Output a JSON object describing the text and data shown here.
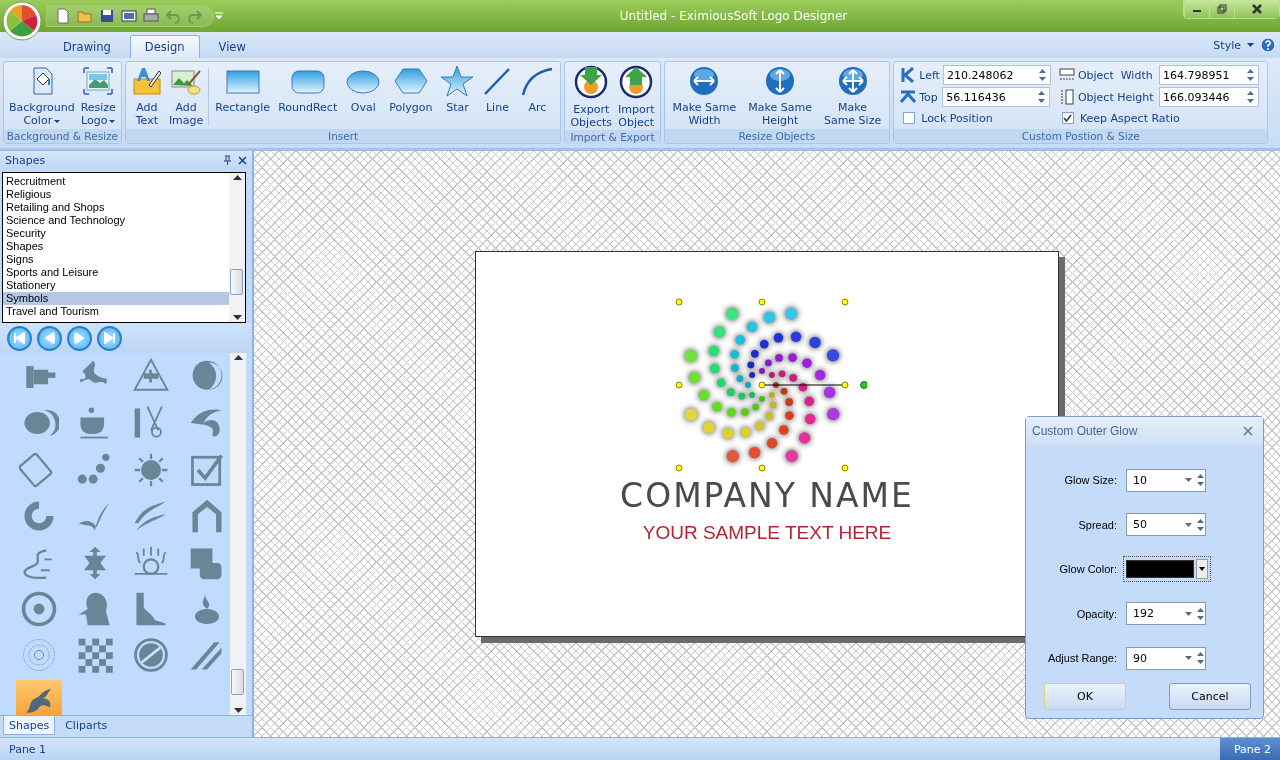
{
  "window": {
    "title": "Untitled - EximiousSoft Logo Designer"
  },
  "tabs": [
    {
      "label": "Drawing",
      "selected": false
    },
    {
      "label": "Design",
      "selected": true
    },
    {
      "label": "View",
      "selected": false
    }
  ],
  "style_menu": {
    "label": "Style"
  },
  "ribbon_groups": [
    {
      "title": "Background & Resize",
      "buttons": [
        {
          "label": "Background\nColor",
          "kind": "paint",
          "dropdown": true
        },
        {
          "label": "Resize\nLogo",
          "kind": "resize",
          "dropdown": true
        }
      ]
    },
    {
      "title": "Insert",
      "buttons": [
        {
          "label": "Add\nText",
          "kind": "text",
          "dropdown": false
        },
        {
          "label": "Add\nImage",
          "kind": "image",
          "dropdown": false
        },
        {
          "label": "Rectangle",
          "kind": "rect",
          "dropdown": false
        },
        {
          "label": "RoundRect",
          "kind": "roundrect",
          "dropdown": false
        },
        {
          "label": "Oval",
          "kind": "oval",
          "dropdown": false
        },
        {
          "label": "Polygon",
          "kind": "polygon",
          "dropdown": false
        },
        {
          "label": "Star",
          "kind": "star",
          "dropdown": false
        },
        {
          "label": "Line",
          "kind": "line",
          "dropdown": false
        },
        {
          "label": "Arc",
          "kind": "arc",
          "dropdown": false
        }
      ]
    },
    {
      "title": "Import & Export",
      "buttons": [
        {
          "label": "Export\nObjects",
          "kind": "export",
          "dropdown": false
        },
        {
          "label": "Import\nObject",
          "kind": "import",
          "dropdown": false
        }
      ]
    },
    {
      "title": "Resize Objects",
      "buttons": [
        {
          "label": "Make Same\nWidth",
          "kind": "width",
          "dropdown": false
        },
        {
          "label": "Make Same\nHeight",
          "kind": "height",
          "dropdown": false
        },
        {
          "label": "Make\nSame Size",
          "kind": "size",
          "dropdown": false
        }
      ]
    }
  ],
  "position_group": {
    "title": "Custom Postion & Size",
    "fields": [
      {
        "label": "Left",
        "value": "210.248062",
        "kind": "left"
      },
      {
        "label": "Top",
        "value": "56.116436",
        "kind": "top"
      },
      {
        "label": "Object  Width",
        "value": "164.798951",
        "kind": "width"
      },
      {
        "label": "Object Height",
        "value": "166.093446",
        "kind": "height"
      }
    ],
    "checkboxes": [
      {
        "label": "Lock Position",
        "checked": false
      },
      {
        "label": "Keep Aspect Ratio",
        "checked": true
      }
    ]
  },
  "shapes_panel": {
    "title": "Shapes",
    "categories": [
      {
        "label": "Recruitment",
        "selected": false
      },
      {
        "label": "Religious",
        "selected": false
      },
      {
        "label": "Retailing and Shops",
        "selected": false
      },
      {
        "label": "Science and Technology",
        "selected": false
      },
      {
        "label": "Security",
        "selected": false
      },
      {
        "label": "Shapes",
        "selected": false
      },
      {
        "label": "Signs",
        "selected": false
      },
      {
        "label": "Sports and Leisure",
        "selected": false
      },
      {
        "label": "Stationery",
        "selected": false
      },
      {
        "label": "Symbols",
        "selected": true
      },
      {
        "label": "Travel and Tourism",
        "selected": false
      }
    ],
    "thumbnails": [
      {
        "selected": false
      },
      {
        "selected": false
      },
      {
        "selected": false
      },
      {
        "selected": false
      },
      {
        "selected": false
      },
      {
        "selected": false
      },
      {
        "selected": false
      },
      {
        "selected": false
      },
      {
        "selected": false
      },
      {
        "selected": false
      },
      {
        "selected": false
      },
      {
        "selected": false
      },
      {
        "selected": false
      },
      {
        "selected": false
      },
      {
        "selected": false
      },
      {
        "selected": false
      },
      {
        "selected": false
      },
      {
        "selected": false
      },
      {
        "selected": false
      },
      {
        "selected": false
      },
      {
        "selected": false
      },
      {
        "selected": false
      },
      {
        "selected": false
      },
      {
        "selected": false
      },
      {
        "selected": false
      },
      {
        "selected": false
      },
      {
        "selected": false
      },
      {
        "selected": false
      },
      {
        "selected": true
      }
    ],
    "bottom_tabs": [
      {
        "label": "Shapes",
        "selected": true
      },
      {
        "label": "Cliparts",
        "selected": false
      }
    ]
  },
  "logo": {
    "company": "COMPANY NAME",
    "tagline": "YOUR SAMPLE TEXT HERE"
  },
  "dialog": {
    "title": "Custom Outer Glow",
    "rows": [
      {
        "label": "Glow Size:",
        "kind": "spin",
        "value": "10"
      },
      {
        "label": "Spread:",
        "kind": "spin",
        "value": "50"
      },
      {
        "label": "Glow Color:",
        "kind": "color",
        "color": "#000000"
      },
      {
        "label": "Opacity:",
        "kind": "spin",
        "value": "192"
      },
      {
        "label": "Adjust Range:",
        "kind": "spin",
        "value": "90"
      }
    ],
    "buttons": [
      "OK",
      "Cancel"
    ]
  },
  "status_bar": {
    "left": "Pane 1",
    "right": "Pane 2"
  }
}
